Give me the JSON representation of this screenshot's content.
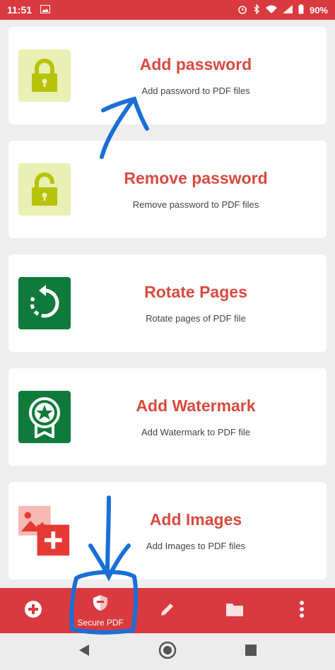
{
  "status_bar": {
    "time": "11:51",
    "battery": "90%",
    "icons": [
      "image-icon",
      "alarm-icon",
      "bluetooth-icon",
      "wifi-icon",
      "signal-icon",
      "battery-icon"
    ]
  },
  "cards": [
    {
      "title": "Add password",
      "subtitle": "Add password to PDF files",
      "icon": "lock-icon"
    },
    {
      "title": "Remove password",
      "subtitle": "Remove password to PDF files",
      "icon": "unlock-icon"
    },
    {
      "title": "Rotate Pages",
      "subtitle": "Rotate pages of PDF file",
      "icon": "rotate-icon"
    },
    {
      "title": "Add Watermark",
      "subtitle": "Add Watermark to PDF file",
      "icon": "badge-star-icon"
    },
    {
      "title": "Add Images",
      "subtitle": "Add Images to PDF files",
      "icon": "image-add-icon"
    }
  ],
  "bottom_nav": {
    "items": [
      {
        "icon": "add-circle-icon",
        "label": ""
      },
      {
        "icon": "shield-icon",
        "label": "Secure PDF"
      },
      {
        "icon": "pencil-icon",
        "label": ""
      },
      {
        "icon": "folder-icon",
        "label": ""
      },
      {
        "icon": "more-vert-icon",
        "label": ""
      }
    ]
  },
  "system_nav": [
    "back-icon",
    "home-icon",
    "recents-icon"
  ],
  "colors": {
    "brand": "#d93a3f",
    "title_text": "#d94a3f",
    "lime_bg": "#e9f0b3",
    "lime_fg": "#b9c20b",
    "green": "#0f7a3a",
    "annotation": "#1a6fd6"
  }
}
